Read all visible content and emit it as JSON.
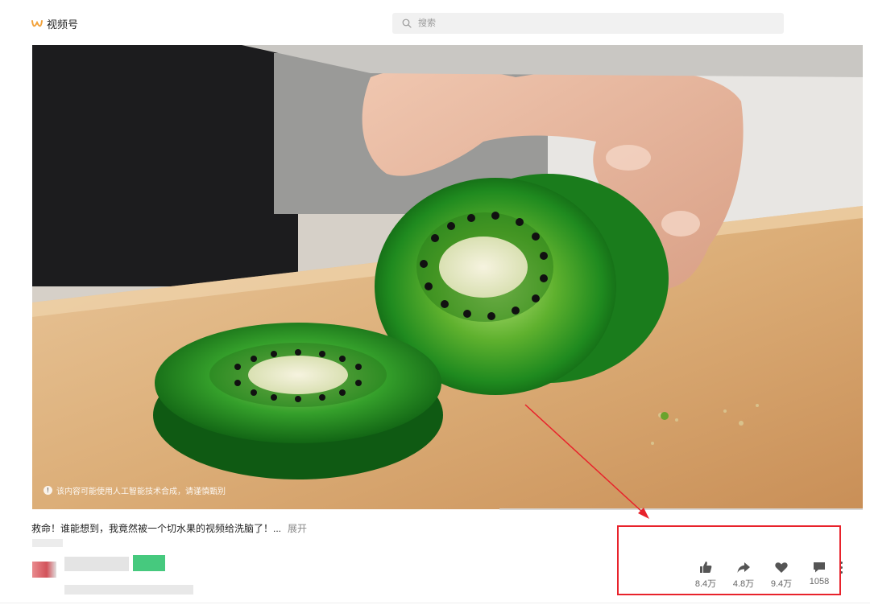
{
  "header": {
    "logo_text": "视频号",
    "logo_icon": "channels-logo-icon",
    "search_placeholder": "搜索"
  },
  "video": {
    "ai_notice": "该内容可能使用人工智能技术合成，请谨慎甄别"
  },
  "caption": {
    "text": "救命！谁能想到，我竟然被一个切水果的视频给洗脑了！...",
    "more": "展开"
  },
  "actions": [
    {
      "icon": "thumbs-up-icon",
      "count": "8.4万"
    },
    {
      "icon": "share-icon",
      "count": "4.8万"
    },
    {
      "icon": "heart-icon",
      "count": "9.4万"
    },
    {
      "icon": "comment-icon",
      "count": "1058"
    }
  ],
  "colors": {
    "accent_logo": "#f2a23a",
    "annotation_red": "#e8222b",
    "badge_green": "#46c97e"
  }
}
